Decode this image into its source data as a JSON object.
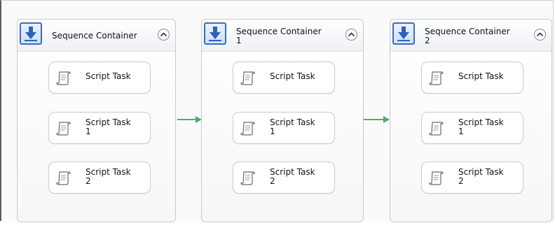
{
  "containers": [
    {
      "title": "Sequence Container",
      "tasks": [
        {
          "label": "Script Task"
        },
        {
          "label": "Script Task\n1"
        },
        {
          "label": "Script Task\n2"
        }
      ]
    },
    {
      "title": "Sequence Container\n1",
      "tasks": [
        {
          "label": "Script Task"
        },
        {
          "label": "Script Task\n1"
        },
        {
          "label": "Script Task\n2"
        }
      ]
    },
    {
      "title": "Sequence Container\n2",
      "tasks": [
        {
          "label": "Script Task"
        },
        {
          "label": "Script Task\n1"
        },
        {
          "label": "Script Task\n2"
        }
      ]
    }
  ],
  "icons": {
    "container": "sequence-container-icon",
    "collapse": "collapse-chevron-icon",
    "task": "script-task-icon"
  },
  "colors": {
    "precedence_arrow": "#4cae6a",
    "container_border": "#c5cbd3",
    "icon_blue": "#3b6cc0"
  }
}
